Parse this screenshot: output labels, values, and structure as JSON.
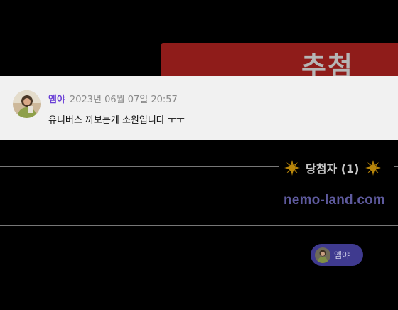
{
  "banner": {
    "title": "추첨"
  },
  "comment": {
    "author": "엠야",
    "date": "2023년 06월 07일 20:57",
    "text": "유니버스 까보는게 소원입니다 ㅜㅜ",
    "avatar_icon": "user-avatar-photo"
  },
  "winners": {
    "heading": "당첨자 (1)",
    "heading_icon": "sun-icon",
    "site": "nemo-land.com",
    "list": [
      {
        "name": "엠야",
        "avatar_icon": "user-avatar-photo"
      }
    ]
  },
  "colors": {
    "background": "#000000",
    "banner": "#8f1c1a",
    "author": "#6a3fd6",
    "site_link": "#5e5a9e",
    "winner_pill": "#3f3a8f",
    "sun": "#b8860b"
  }
}
